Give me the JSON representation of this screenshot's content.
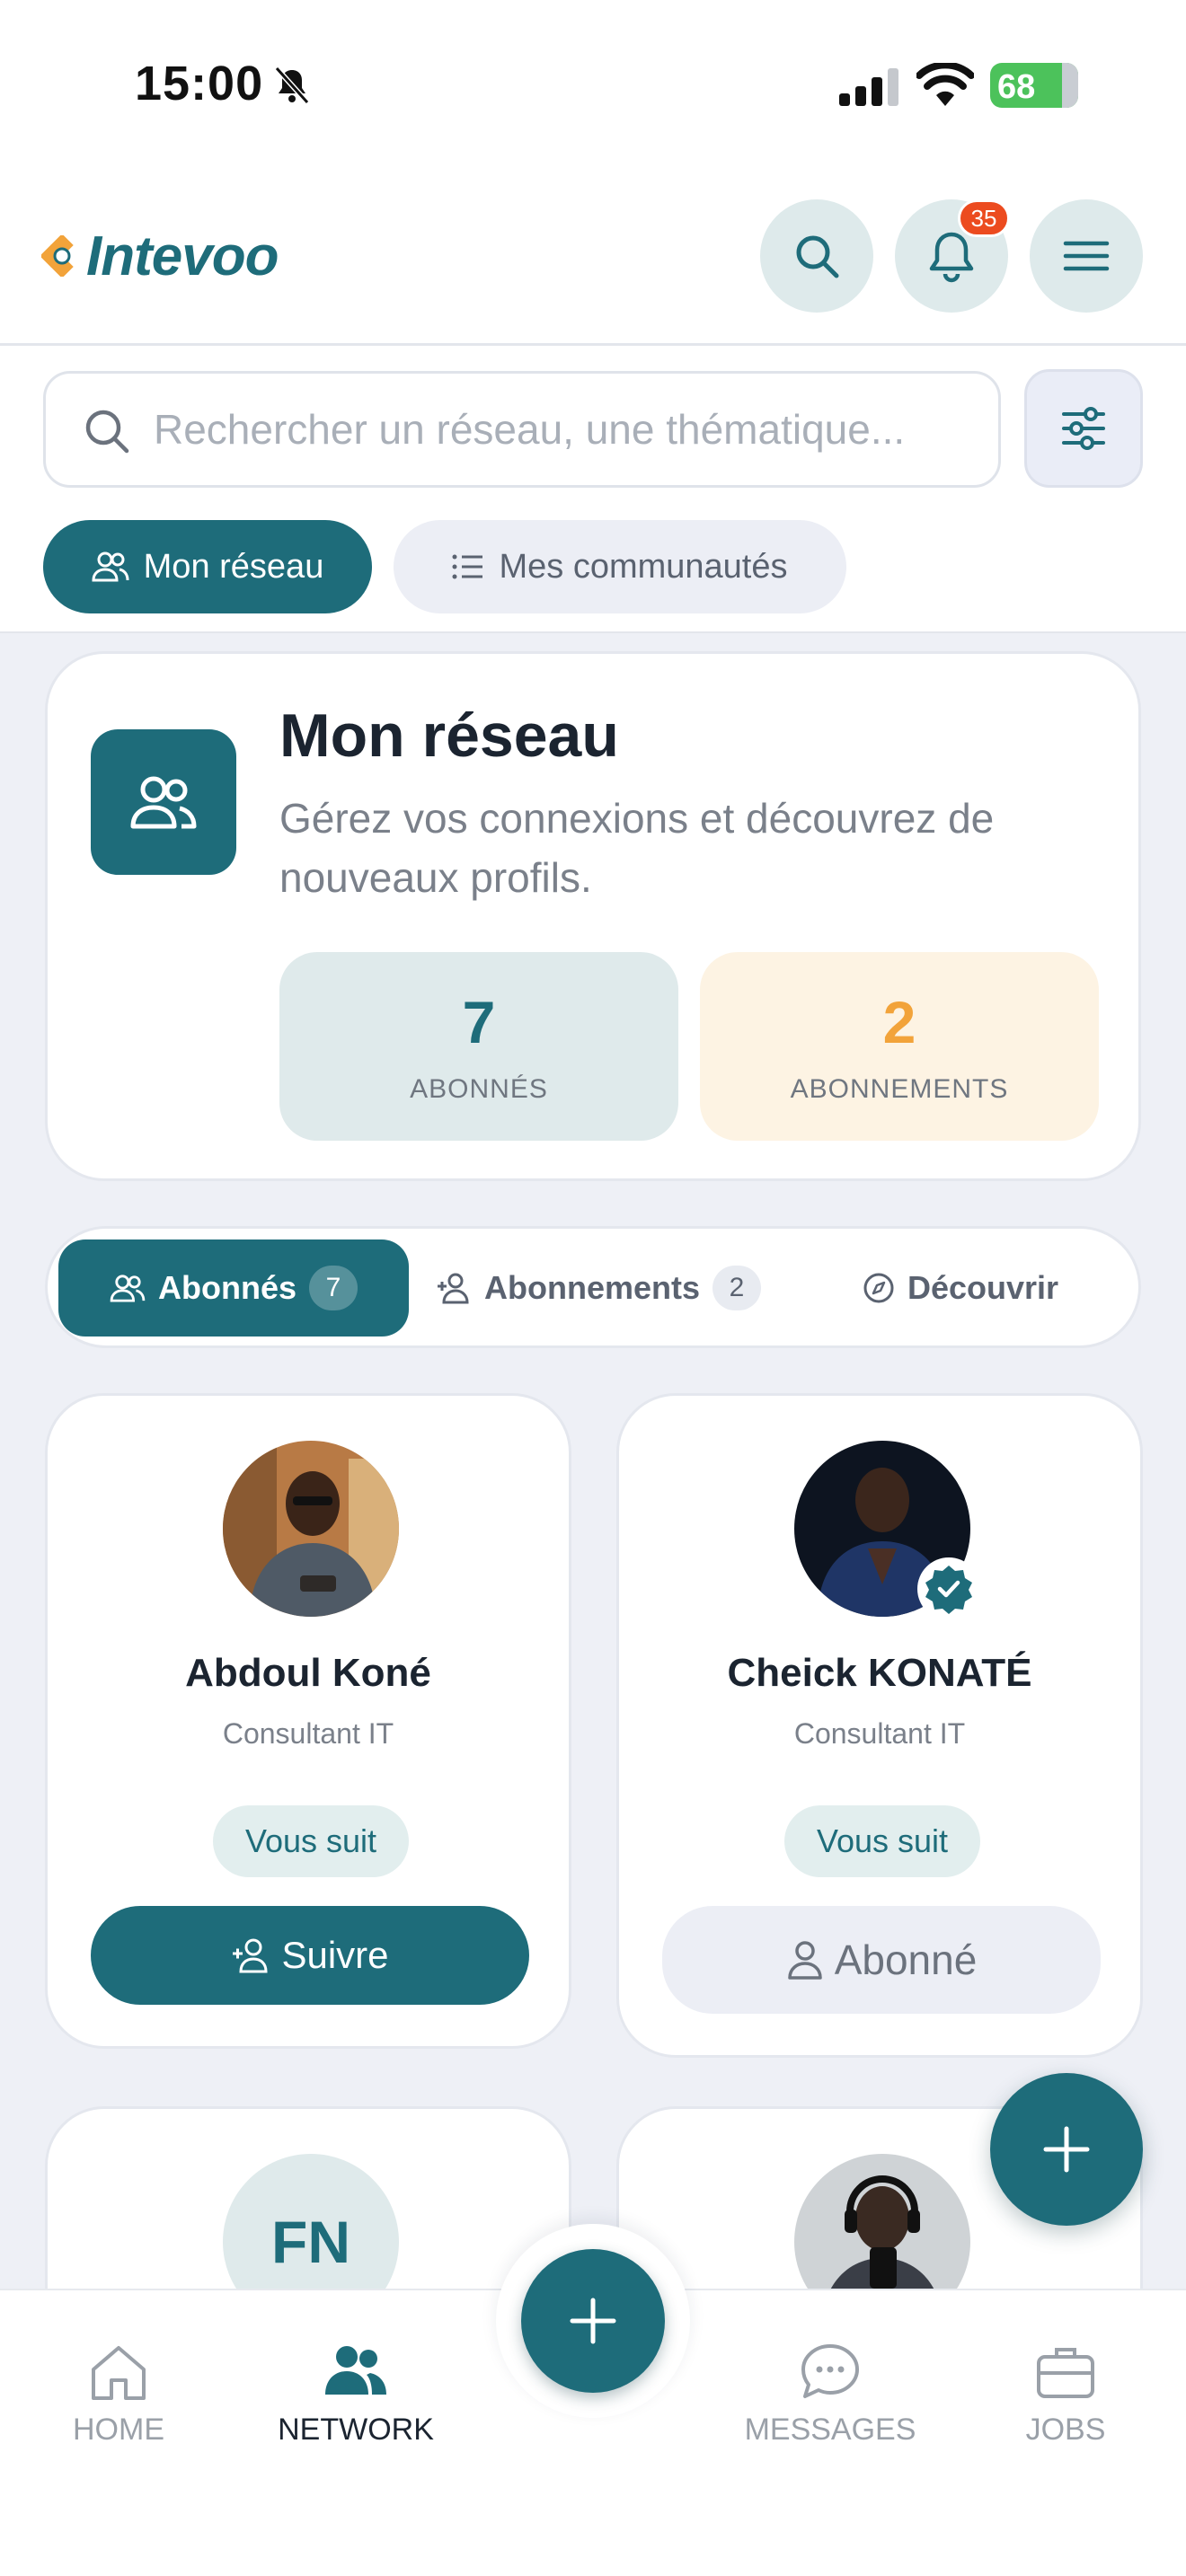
{
  "status_bar": {
    "time": "15:00",
    "battery": "68"
  },
  "header": {
    "logo_text": "Intevoo",
    "notification_count": "35"
  },
  "search": {
    "placeholder": "Rechercher un réseau, une thématique..."
  },
  "segments": {
    "active": "Mon réseau",
    "inactive": "Mes communautés"
  },
  "summary": {
    "title": "Mon réseau",
    "subtitle": "Gérez vos connexions et découvrez de nouveaux profils.",
    "followers_count": "7",
    "followers_label": "ABONNÉS",
    "following_count": "2",
    "following_label": "ABONNEMENTS"
  },
  "tabs": [
    {
      "label": "Abonnés",
      "count": "7"
    },
    {
      "label": "Abonnements",
      "count": "2"
    },
    {
      "label": "Découvrir"
    }
  ],
  "people": [
    {
      "name": "Abdoul Koné",
      "role": "Consultant IT",
      "badge": "Vous suit",
      "action": "Suivre"
    },
    {
      "name": "Cheick KONATÉ",
      "role": "Consultant IT",
      "badge": "Vous suit",
      "action": "Abonné"
    },
    {
      "initials": "FN"
    },
    {}
  ],
  "bottom_nav": [
    {
      "label": "HOME"
    },
    {
      "label": "NETWORK"
    },
    {
      "label": "MESSAGES"
    },
    {
      "label": "JOBS"
    }
  ],
  "colors": {
    "primary": "#1e6c7a",
    "accent": "#f2a33a",
    "badge": "#ec4b1f"
  }
}
